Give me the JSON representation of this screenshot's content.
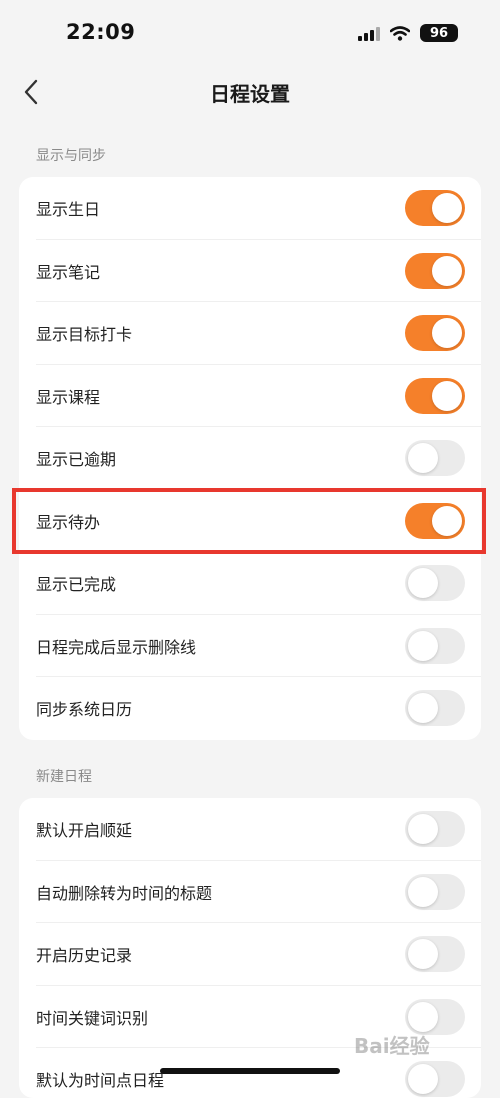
{
  "status_bar": {
    "time": "22:09",
    "battery": "96"
  },
  "nav": {
    "title": "日程设置",
    "back_icon": "chevron-left-icon"
  },
  "sections": [
    {
      "title": "显示与同步",
      "items": [
        {
          "label": "显示生日",
          "on": true
        },
        {
          "label": "显示笔记",
          "on": true
        },
        {
          "label": "显示目标打卡",
          "on": true
        },
        {
          "label": "显示课程",
          "on": true
        },
        {
          "label": "显示已逾期",
          "on": false
        },
        {
          "label": "显示待办",
          "on": true
        },
        {
          "label": "显示已完成",
          "on": false
        },
        {
          "label": "日程完成后显示删除线",
          "on": false
        },
        {
          "label": "同步系统日历",
          "on": false
        }
      ]
    },
    {
      "title": "新建日程",
      "items": [
        {
          "label": "默认开启顺延",
          "on": false
        },
        {
          "label": "自动删除转为时间的标题",
          "on": false
        },
        {
          "label": "开启历史记录",
          "on": false
        },
        {
          "label": "时间关键词识别",
          "on": false
        },
        {
          "label": "默认为时间点日程",
          "on": false
        }
      ]
    }
  ],
  "colors": {
    "accent": "#f5802a",
    "highlight": "#e8382e"
  },
  "watermark": "Bai经验"
}
